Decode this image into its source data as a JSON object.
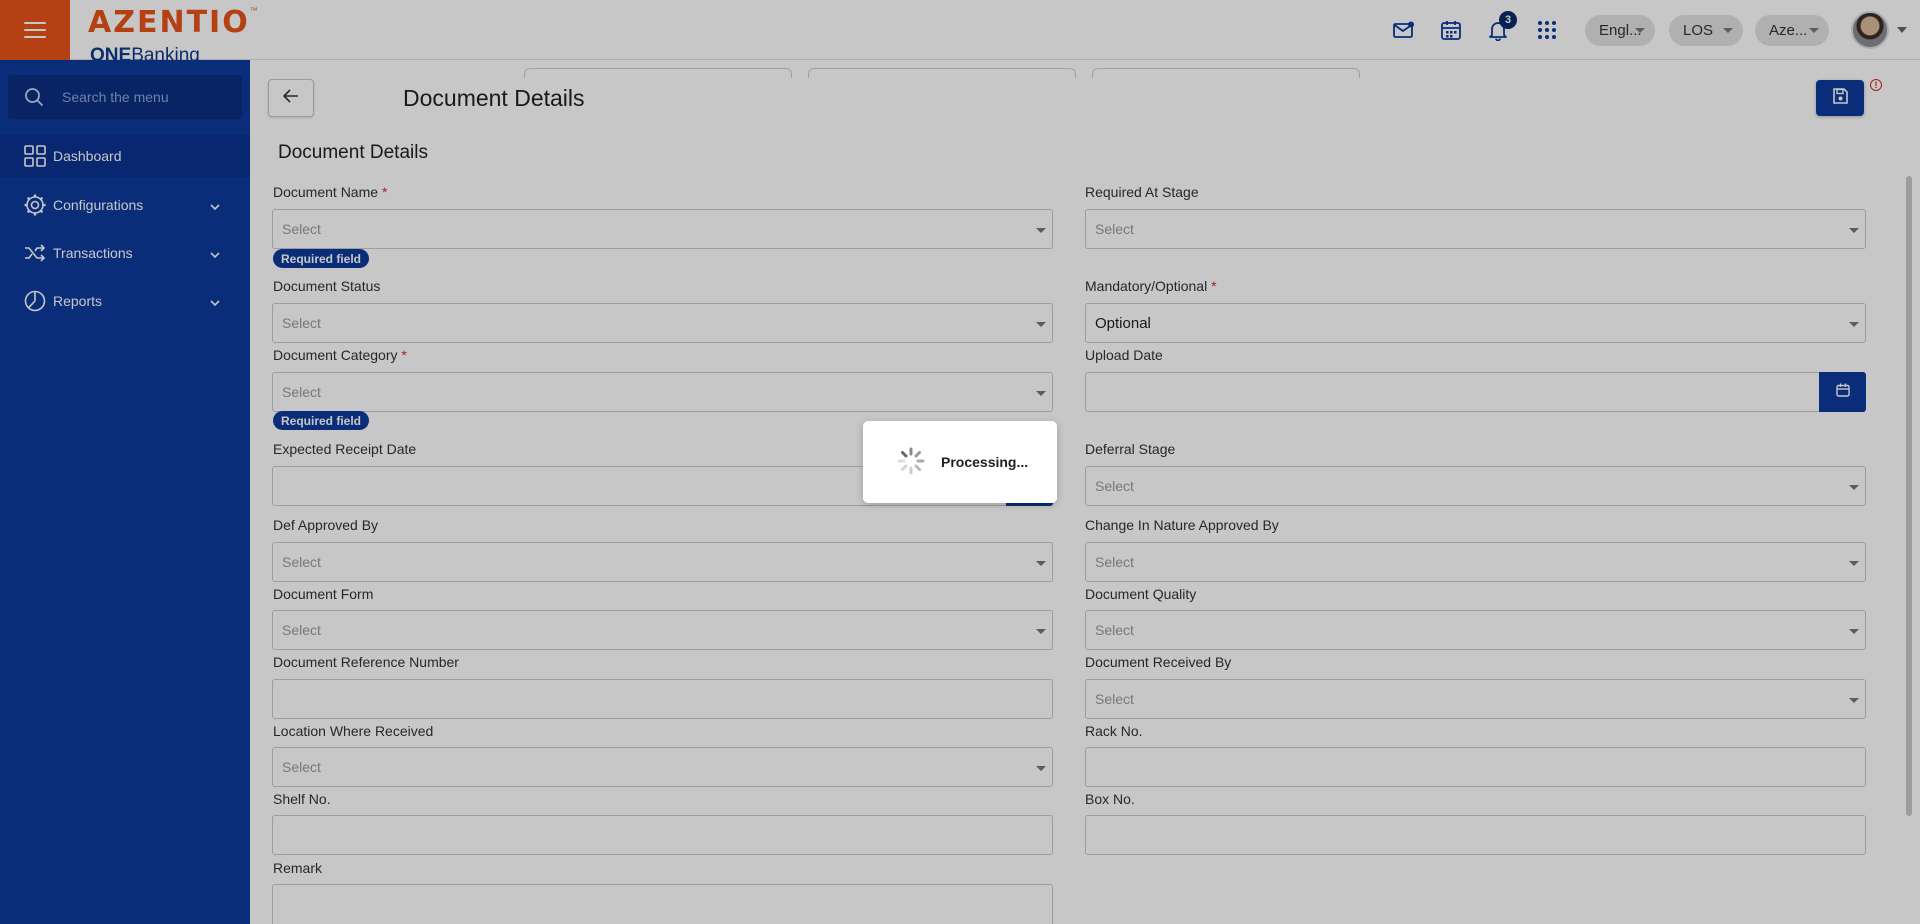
{
  "header": {
    "brand_name": "AZENTIO",
    "brand_tm": "™",
    "brand_sub_bold": "ONE",
    "brand_sub_light": "Banking",
    "notification_count": "3",
    "language": "Engl...",
    "module": "LOS",
    "entity": "Aze..."
  },
  "sidebar": {
    "search_placeholder": "Search the menu",
    "items": [
      {
        "label": "Dashboard",
        "icon": "grid-icon"
      },
      {
        "label": "Configurations",
        "icon": "gear-icon"
      },
      {
        "label": "Transactions",
        "icon": "shuffle-icon"
      },
      {
        "label": "Reports",
        "icon": "pie-chart-icon"
      }
    ]
  },
  "page": {
    "title": "Document Details",
    "section_title": "Document Details",
    "required_badge": "Required field",
    "placeholder": "Select"
  },
  "form": {
    "document_name": "Document Name",
    "required_at_stage": "Required At Stage",
    "document_status": "Document Status",
    "mandatory_optional": "Mandatory/Optional",
    "mandatory_optional_value": "Optional",
    "document_category": "Document Category",
    "upload_date": "Upload Date",
    "expected_receipt_date": "Expected Receipt Date",
    "deferral_stage": "Deferral Stage",
    "def_approved_by": "Def Approved By",
    "change_in_nature_approved_by": "Change In Nature Approved By",
    "document_form": "Document Form",
    "document_quality": "Document Quality",
    "document_reference_number": "Document Reference Number",
    "document_received_by": "Document Received By",
    "location_where_received": "Location Where Received",
    "rack_no": "Rack No.",
    "shelf_no": "Shelf No.",
    "box_no": "Box No.",
    "remark": "Remark"
  },
  "overlay": {
    "processing_text": "Processing..."
  },
  "colors": {
    "brand_orange": "#e8521a",
    "primary_blue": "#0d3a9c",
    "required_red": "#d62828"
  }
}
